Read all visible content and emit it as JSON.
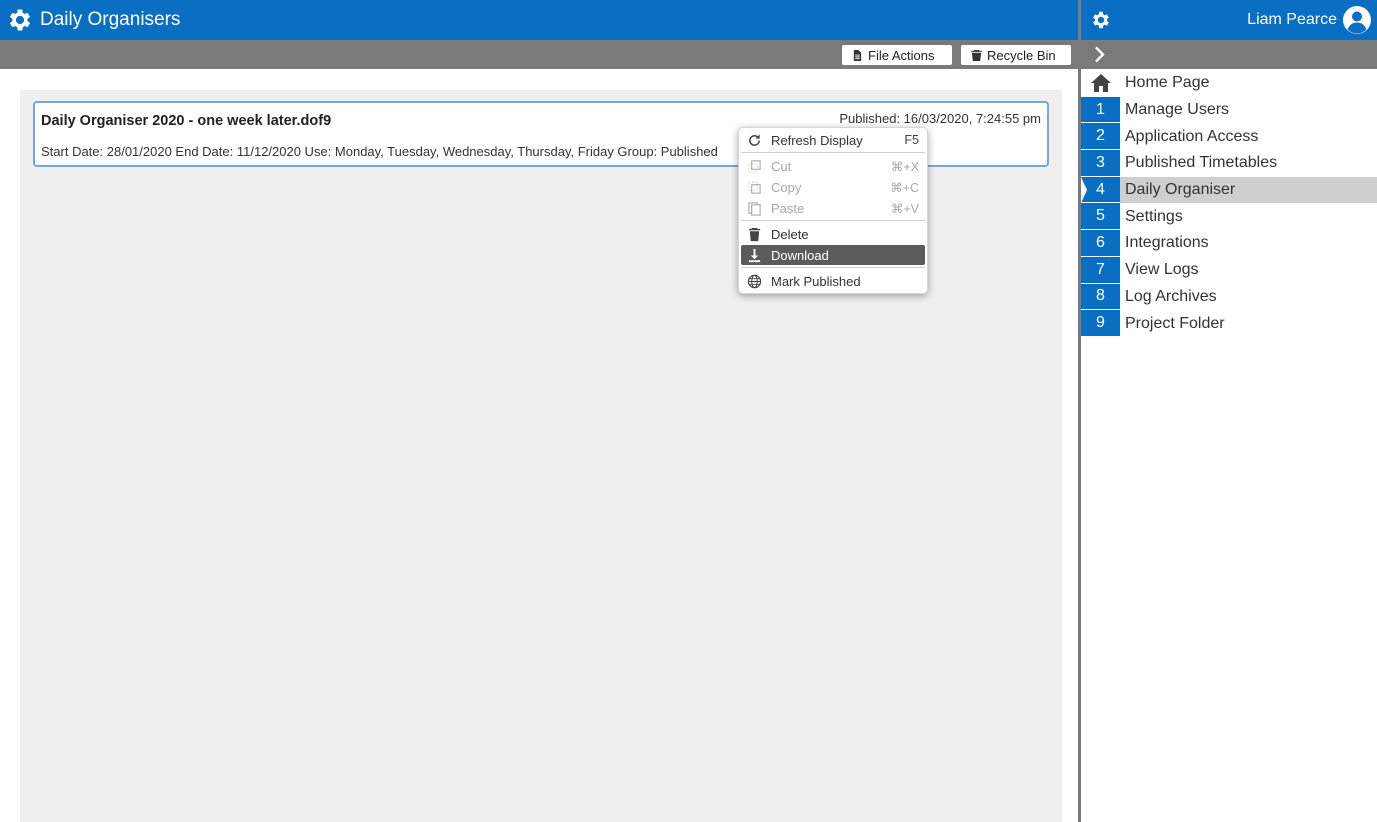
{
  "app": {
    "title": "Daily Organisers"
  },
  "toolbar": {
    "file_actions": "File Actions",
    "recycle_bin": "Recycle Bin"
  },
  "card": {
    "filename": "Daily Organiser 2020 - one week later.dof9",
    "published": "Published: 16/03/2020, 7:24:55 pm",
    "meta": "Start Date: 28/01/2020  End Date: 11/12/2020  Use: Monday, Tuesday, Wednesday, Thursday, Friday  Group: Published"
  },
  "context_menu": {
    "refresh": {
      "label": "Refresh Display",
      "shortcut": "F5"
    },
    "cut": {
      "label": "Cut",
      "shortcut": "⌘+X"
    },
    "copy": {
      "label": "Copy",
      "shortcut": "⌘+C"
    },
    "paste": {
      "label": "Paste",
      "shortcut": "⌘+V"
    },
    "delete": {
      "label": "Delete"
    },
    "download": {
      "label": "Download"
    },
    "mark_published": {
      "label": "Mark Published"
    }
  },
  "sidebar": {
    "user_name": "Liam Pearce",
    "items": [
      {
        "number": "",
        "label": "Home Page",
        "icon": "home-icon"
      },
      {
        "number": "1",
        "label": "Manage Users"
      },
      {
        "number": "2",
        "label": "Application Access"
      },
      {
        "number": "3",
        "label": "Published Timetables"
      },
      {
        "number": "4",
        "label": "Daily Organiser",
        "active": true
      },
      {
        "number": "5",
        "label": "Settings"
      },
      {
        "number": "6",
        "label": "Integrations"
      },
      {
        "number": "7",
        "label": "View Logs"
      },
      {
        "number": "8",
        "label": "Log Archives"
      },
      {
        "number": "9",
        "label": "Project Folder"
      }
    ]
  },
  "colors": {
    "brand_blue": "#0a6fc2",
    "toolbar_gray": "#7a7a7a",
    "active_gray": "#cfcfcf",
    "highlight_dark": "#5b5b5b"
  }
}
